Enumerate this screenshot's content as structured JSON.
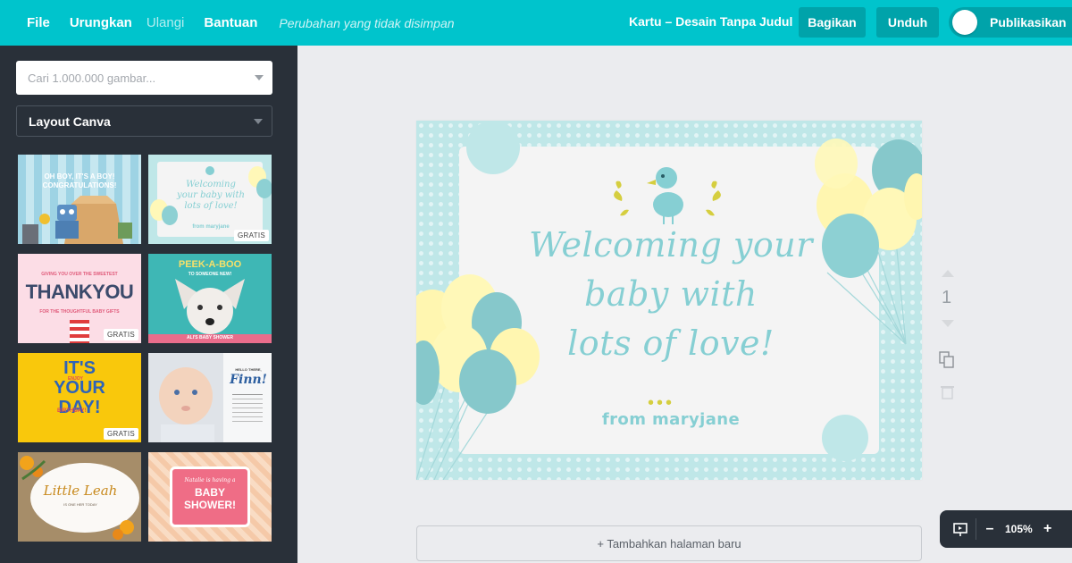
{
  "topbar": {
    "menu": [
      {
        "label": "File"
      },
      {
        "label": "Urungkan"
      },
      {
        "label": "Ulangi"
      },
      {
        "label": "Bantuan"
      }
    ],
    "status": "Perubahan yang tidak disimpan",
    "design_title": "Kartu – Desain Tanpa Judul",
    "share_label": "Bagikan",
    "download_label": "Unduh",
    "publish_label": "Publikasikan",
    "accent": "#00c4cc"
  },
  "sidebar": {
    "search_placeholder": "Cari 1.000.000 gambar...",
    "layout_select": "Layout Canva",
    "badge": "GRATIS",
    "thumbs": [
      {
        "text": "OH BOY, IT'S A BOY! CONGRATULATIONS!"
      },
      {
        "text": "Welcoming your baby with lots of love!",
        "sub": "from maryjane"
      },
      {
        "text": "THANKYOU",
        "top": "GIVING YOU OVER THE SWEETEST",
        "sub": "FOR THE THOUGHTFUL BABY GIFTS"
      },
      {
        "text": "PEEK-A-BOO",
        "top": "TO SOMEONE NEW!",
        "sub": "ALI'S BABY SHOWER"
      },
      {
        "text": "IT'S YOUR DAY!",
        "top": "ENJOY",
        "sub": "BIRTHDAY!"
      },
      {
        "text": "Finn!",
        "top": "HELLO THERE,"
      },
      {
        "text": "Little Leah",
        "sub": "IS ONE HER TODAY"
      },
      {
        "text": "BABY SHOWER!",
        "top": "Natalie is having a"
      }
    ]
  },
  "canvas": {
    "headline_lines": [
      "Welcoming your",
      "baby with",
      "lots of love!"
    ],
    "dots": "•••",
    "from": "from maryjane",
    "page_number": "1",
    "add_page": "+ Tambahkan halaman baru",
    "zoom": "105%"
  }
}
